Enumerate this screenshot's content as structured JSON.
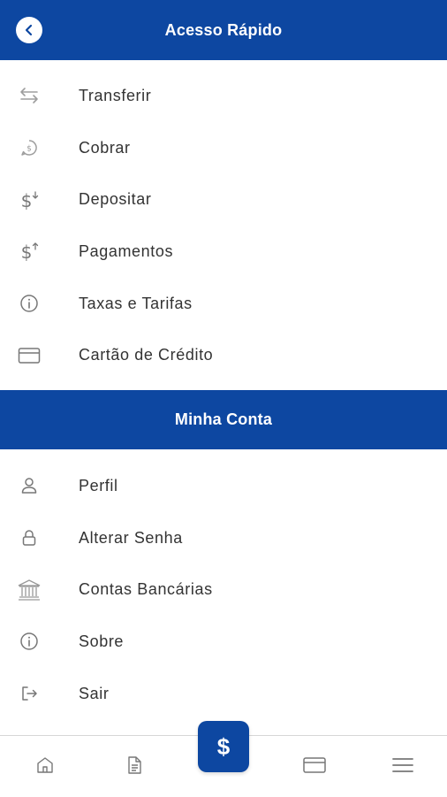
{
  "header": {
    "title": "Acesso Rápido",
    "back_icon": "chevron-left-icon"
  },
  "quick_access": {
    "items": [
      {
        "label": "Transferir",
        "icon": "transfer-arrows-icon"
      },
      {
        "label": "Cobrar",
        "icon": "charge-bubble-icon"
      },
      {
        "label": "Depositar",
        "icon": "dollar-down-icon"
      },
      {
        "label": "Pagamentos",
        "icon": "dollar-up-icon"
      },
      {
        "label": "Taxas e Tarifas",
        "icon": "info-icon"
      },
      {
        "label": "Cartão de Crédito",
        "icon": "credit-card-icon"
      }
    ]
  },
  "account": {
    "title": "Minha Conta",
    "items": [
      {
        "label": "Perfil",
        "icon": "user-icon"
      },
      {
        "label": "Alterar Senha",
        "icon": "lock-icon"
      },
      {
        "label": "Contas Bancárias",
        "icon": "bank-icon"
      },
      {
        "label": "Sobre",
        "icon": "info-icon"
      },
      {
        "label": "Sair",
        "icon": "logout-icon"
      }
    ]
  },
  "bottom_nav": {
    "fab_symbol": "$",
    "items": [
      "home-icon",
      "document-icon",
      "dollar-icon",
      "credit-card-icon",
      "menu-icon"
    ]
  },
  "colors": {
    "primary": "#0d47a1",
    "text": "#333333",
    "icon": "#9e9e9e"
  }
}
